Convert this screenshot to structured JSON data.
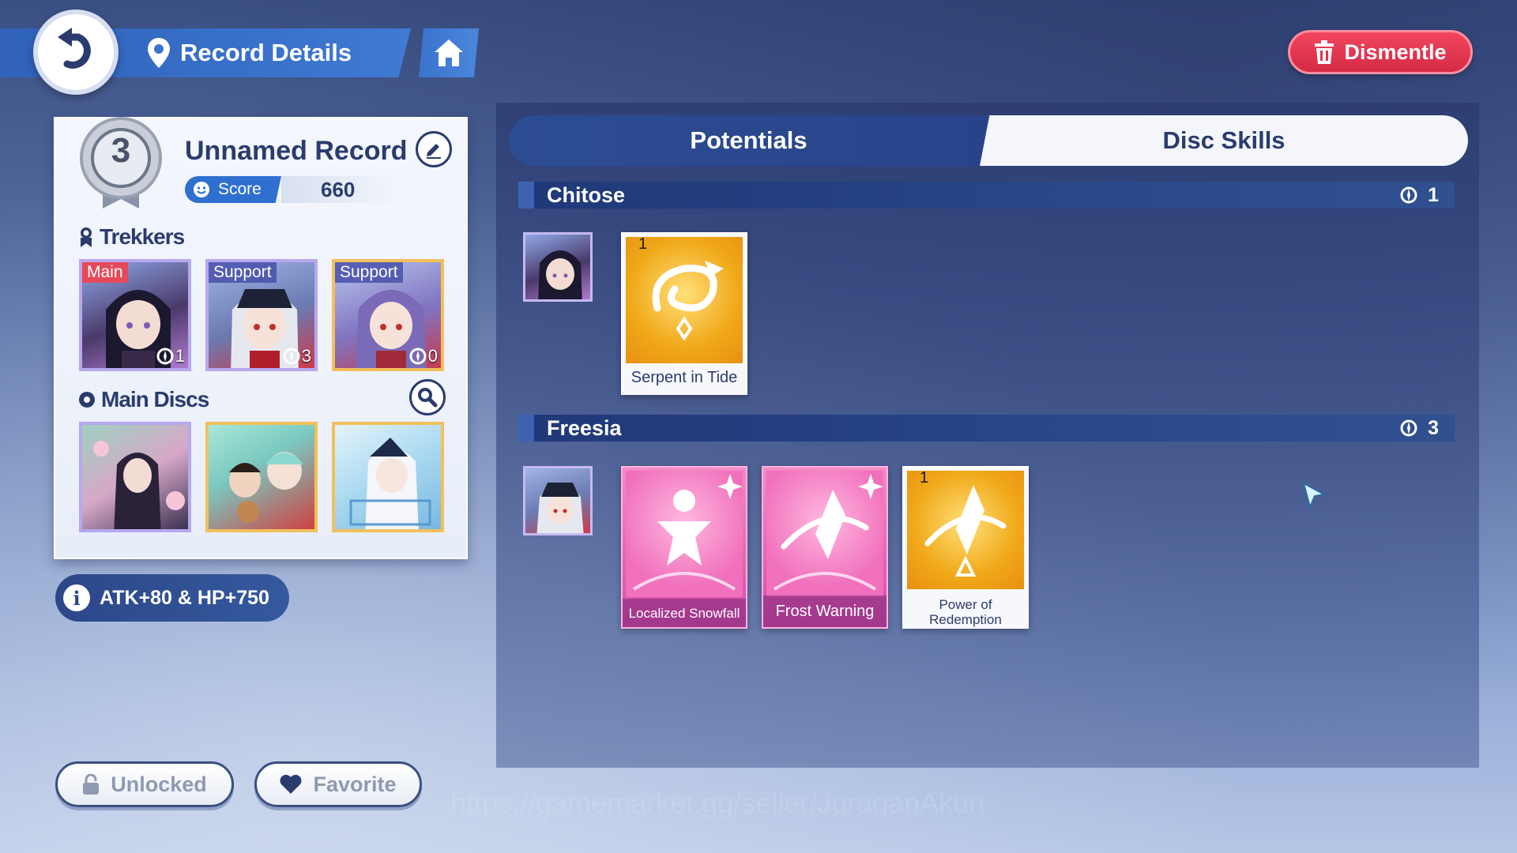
{
  "header": {
    "title": "Record Details",
    "dismantle_label": "Dismentle"
  },
  "record": {
    "rank": "3",
    "name": "Unnamed Record",
    "score_label": "Score",
    "score_value": "660",
    "trekkers_heading": "Trekkers",
    "discs_heading": "Main Discs",
    "trekkers": [
      {
        "tag": "Main",
        "potential": "1"
      },
      {
        "tag": "Support",
        "potential": "3"
      },
      {
        "tag": "Support",
        "potential": "0"
      }
    ]
  },
  "stat_bonus": "ATK+80 & HP+750",
  "bottom": {
    "unlocked_label": "Unlocked",
    "favorite_label": "Favorite"
  },
  "tabs": [
    {
      "label": "Potentials",
      "active": false
    },
    {
      "label": "Disc Skills",
      "active": true
    }
  ],
  "characters": [
    {
      "name": "Chitose",
      "count": "1",
      "skills": [
        {
          "name": "Serpent in Tide",
          "level": "1",
          "style": "gold"
        }
      ]
    },
    {
      "name": "Freesia",
      "count": "3",
      "skills": [
        {
          "name": "Localized Snowfall",
          "level": "",
          "style": "pink"
        },
        {
          "name": "Frost Warning",
          "level": "",
          "style": "pink"
        },
        {
          "name": "Power of Redemption",
          "level": "1",
          "style": "gold"
        }
      ]
    }
  ],
  "watermark": "https://gamemarket.gg/seller/JuraganAkun",
  "colors": {
    "accent_blue": "#2f6fd0",
    "dismantle_red": "#e0334f",
    "panel_navy": "#26407e"
  }
}
